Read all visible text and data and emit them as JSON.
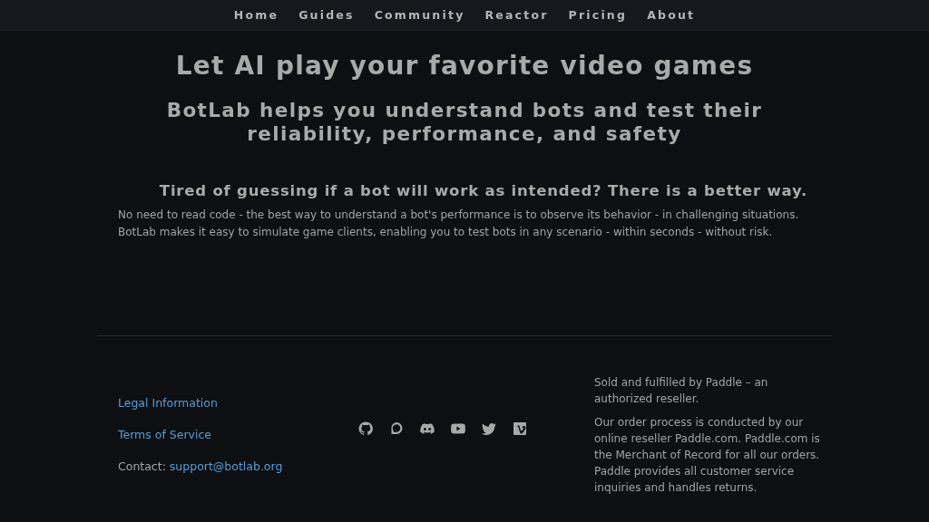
{
  "nav": [
    {
      "label": "Home"
    },
    {
      "label": "Guides"
    },
    {
      "label": "Community"
    },
    {
      "label": "Reactor"
    },
    {
      "label": "Pricing"
    },
    {
      "label": "About"
    }
  ],
  "hero": {
    "title": "Let AI play your favorite video games",
    "subtitle": "BotLab helps you understand bots and test their reliability, performance, and safety"
  },
  "section": {
    "heading": "Tired of guessing if a bot will work as intended? There is a better way.",
    "paragraphs": [
      "No need to read code - the best way to understand a bot's performance is to observe its behavior - in challenging situations.",
      "BotLab makes it easy to simulate game clients, enabling you to test bots in any scenario - within seconds - without risk."
    ]
  },
  "footer": {
    "links": [
      "Legal Information",
      "Terms of Service"
    ],
    "contact_label": "Contact:",
    "contact_email": "support@botlab.org",
    "social": [
      {
        "kind": "github"
      },
      {
        "kind": "chat"
      },
      {
        "kind": "discord"
      },
      {
        "kind": "youtube"
      },
      {
        "kind": "twitter"
      },
      {
        "kind": "vimeo"
      }
    ],
    "notes": [
      "Sold and fulfilled by Paddle – an authorized reseller.",
      "Our order process is conducted by our online reseller Paddle.com. Paddle.com is the Merchant of Record for all our orders. Paddle provides all customer service inquiries and handles returns."
    ]
  }
}
